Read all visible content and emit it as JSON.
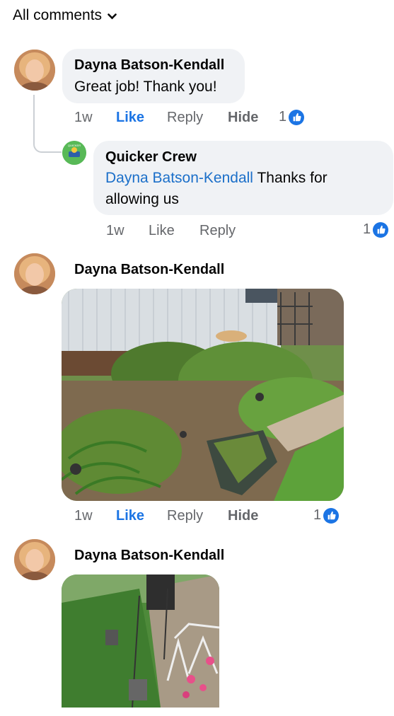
{
  "header": {
    "label": "All comments"
  },
  "comments": [
    {
      "author": "Dayna Batson-Kendall",
      "text": "Great job! Thank you!",
      "time": "1w",
      "like": "Like",
      "reply": "Reply",
      "hide": "Hide",
      "reactions": "1"
    },
    {
      "author": "Quicker Crew",
      "mention": "Dayna Batson-Kendall",
      "text_line1": "Thanks for",
      "text_line2": "allowing us",
      "time": "1w",
      "like": "Like",
      "reply": "Reply",
      "reactions": "1"
    },
    {
      "author": "Dayna Batson-Kendall",
      "time": "1w",
      "like": "Like",
      "reply": "Reply",
      "hide": "Hide",
      "reactions": "1"
    },
    {
      "author": "Dayna Batson-Kendall"
    }
  ],
  "colors": {
    "like_blue": "#1b74e4",
    "mention_blue": "#1b6fc9",
    "bubble_bg": "#f0f2f5",
    "meta_gray": "#65676b"
  },
  "icons": [
    "chevron-down-icon",
    "thumbs-up-icon"
  ]
}
